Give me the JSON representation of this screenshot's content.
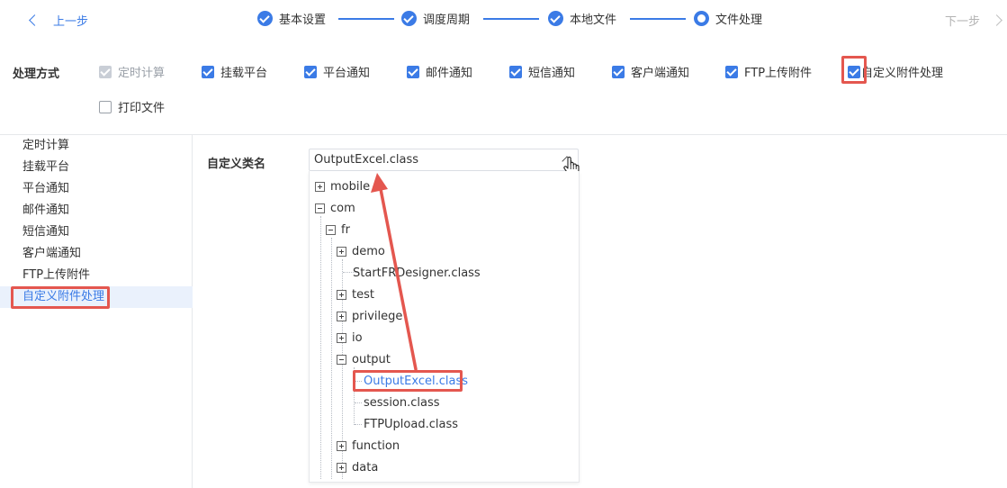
{
  "nav": {
    "prev_label": "上一步",
    "next_label": "下一步"
  },
  "steps": [
    {
      "label": "基本设置",
      "state": "done"
    },
    {
      "label": "调度周期",
      "state": "done"
    },
    {
      "label": "本地文件",
      "state": "done"
    },
    {
      "label": "文件处理",
      "state": "current"
    }
  ],
  "methods": {
    "label": "处理方式",
    "options": [
      {
        "label": "定时计算",
        "state": "checked-disabled"
      },
      {
        "label": "挂载平台",
        "state": "checked"
      },
      {
        "label": "平台通知",
        "state": "checked"
      },
      {
        "label": "邮件通知",
        "state": "checked"
      },
      {
        "label": "短信通知",
        "state": "checked"
      },
      {
        "label": "客户端通知",
        "state": "checked"
      },
      {
        "label": "FTP上传附件",
        "state": "checked"
      },
      {
        "label": "自定义附件处理",
        "state": "checked"
      },
      {
        "label": "打印文件",
        "state": "unchecked"
      }
    ]
  },
  "sidebar": {
    "items": [
      {
        "label": "定时计算"
      },
      {
        "label": "挂载平台"
      },
      {
        "label": "平台通知"
      },
      {
        "label": "邮件通知"
      },
      {
        "label": "短信通知"
      },
      {
        "label": "客户端通知"
      },
      {
        "label": "FTP上传附件"
      },
      {
        "label": "自定义附件处理",
        "active": true
      }
    ]
  },
  "content": {
    "field_label": "自定义类名",
    "selected_value": "OutputExcel.class"
  },
  "tree": {
    "nodes": [
      {
        "label": "mobile",
        "toggle": "plus"
      },
      {
        "label": "com",
        "toggle": "minus"
      },
      {
        "label": "fr",
        "toggle": "minus"
      },
      {
        "label": "demo",
        "toggle": "plus"
      },
      {
        "label": "StartFRDesigner.class",
        "toggle": "none"
      },
      {
        "label": "test",
        "toggle": "plus"
      },
      {
        "label": "privilege",
        "toggle": "plus"
      },
      {
        "label": "io",
        "toggle": "plus"
      },
      {
        "label": "output",
        "toggle": "minus"
      },
      {
        "label": "OutputExcel.class",
        "toggle": "none",
        "selected": true
      },
      {
        "label": "session.class",
        "toggle": "none"
      },
      {
        "label": "FTPUpload.class",
        "toggle": "none"
      },
      {
        "label": "function",
        "toggle": "plus"
      },
      {
        "label": "data",
        "toggle": "plus"
      }
    ]
  },
  "colors": {
    "accent": "#3b7be6",
    "annotation": "#e4574f"
  }
}
